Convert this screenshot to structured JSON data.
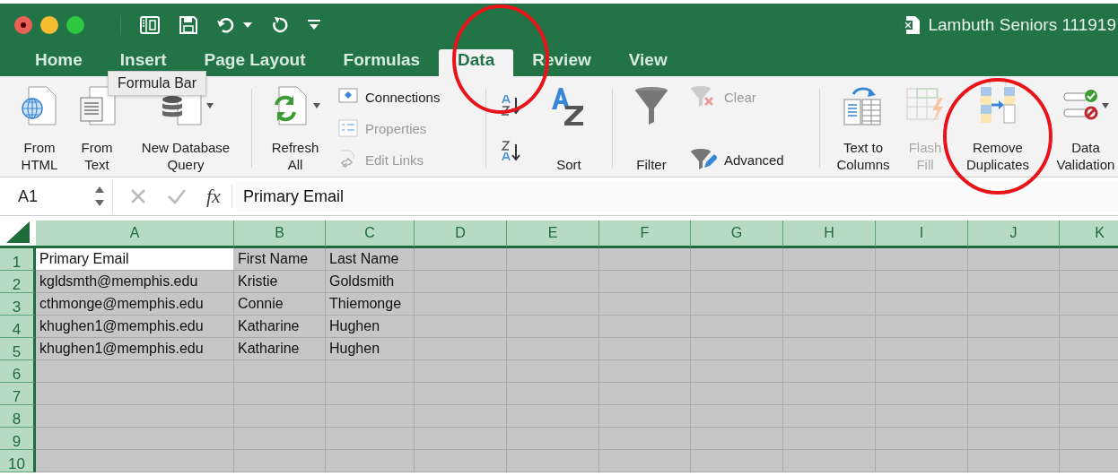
{
  "window": {
    "title": "Lambuth Seniors 111919"
  },
  "tabs": [
    {
      "label": "Home",
      "selected": false
    },
    {
      "label": "Insert",
      "selected": false
    },
    {
      "label": "Page Layout",
      "selected": false
    },
    {
      "label": "Formulas",
      "selected": false
    },
    {
      "label": "Data",
      "selected": true
    },
    {
      "label": "Review",
      "selected": false
    },
    {
      "label": "View",
      "selected": false
    }
  ],
  "tooltip": "Formula Bar",
  "ribbon": {
    "groups": [
      {
        "items": [
          {
            "kind": "big",
            "label": "From HTML",
            "disabled": false
          },
          {
            "kind": "big",
            "label": "From Text",
            "disabled": false
          },
          {
            "kind": "big",
            "label": "New Database Query",
            "disabled": false,
            "menu": true
          }
        ]
      },
      {
        "items": [
          {
            "kind": "big",
            "label": "Refresh All",
            "disabled": false,
            "menu": true
          },
          {
            "kind": "stack",
            "items": [
              {
                "label": "Connections",
                "disabled": false
              },
              {
                "label": "Properties",
                "disabled": true
              },
              {
                "label": "Edit Links",
                "disabled": true
              }
            ]
          }
        ]
      },
      {
        "items": [
          {
            "kind": "sortpair"
          },
          {
            "kind": "big",
            "label": "Sort",
            "disabled": false
          }
        ]
      },
      {
        "items": [
          {
            "kind": "big",
            "label": "Filter",
            "disabled": false
          },
          {
            "kind": "stack",
            "items": [
              {
                "label": "Clear",
                "disabled": true
              },
              {
                "label": "Advanced",
                "disabled": false
              }
            ]
          }
        ]
      },
      {
        "items": [
          {
            "kind": "big",
            "label": "Text to Columns",
            "disabled": false
          },
          {
            "kind": "big",
            "label": "Flash Fill",
            "disabled": true
          },
          {
            "kind": "big",
            "label": "Remove Duplicates",
            "disabled": false
          },
          {
            "kind": "big",
            "label": "Data Validation",
            "disabled": false,
            "menu": true
          }
        ]
      }
    ]
  },
  "formula_bar": {
    "name_box": "A1",
    "fx": "fx",
    "value": "Primary Email"
  },
  "sheet": {
    "columns": [
      {
        "label": "A",
        "selected": true
      },
      {
        "label": "B",
        "selected": true
      },
      {
        "label": "C",
        "selected": true
      },
      {
        "label": "D",
        "selected": true
      },
      {
        "label": "E",
        "selected": true
      },
      {
        "label": "F",
        "selected": true
      },
      {
        "label": "G",
        "selected": true
      },
      {
        "label": "H",
        "selected": true
      },
      {
        "label": "I",
        "selected": true
      },
      {
        "label": "J",
        "selected": true
      },
      {
        "label": "K",
        "selected": true
      }
    ],
    "rows": [
      {
        "number": "1",
        "selected": true,
        "cells": [
          "Primary Email",
          "First Name",
          "Last Name"
        ]
      },
      {
        "number": "2",
        "selected": true,
        "cells": [
          "kgldsmth@memphis.edu",
          "Kristie",
          "Goldsmith"
        ]
      },
      {
        "number": "3",
        "selected": true,
        "cells": [
          "cthmonge@memphis.edu",
          "Connie",
          "Thiemonge"
        ]
      },
      {
        "number": "4",
        "selected": true,
        "cells": [
          "khughen1@memphis.edu",
          "Katharine",
          "Hughen"
        ]
      },
      {
        "number": "5",
        "selected": true,
        "cells": [
          "khughen1@memphis.edu",
          "Katharine",
          "Hughen"
        ]
      },
      {
        "number": "6",
        "selected": true
      },
      {
        "number": "7",
        "selected": true
      },
      {
        "number": "8",
        "selected": true
      },
      {
        "number": "9",
        "selected": true
      },
      {
        "number": "10",
        "selected": true
      }
    ]
  }
}
